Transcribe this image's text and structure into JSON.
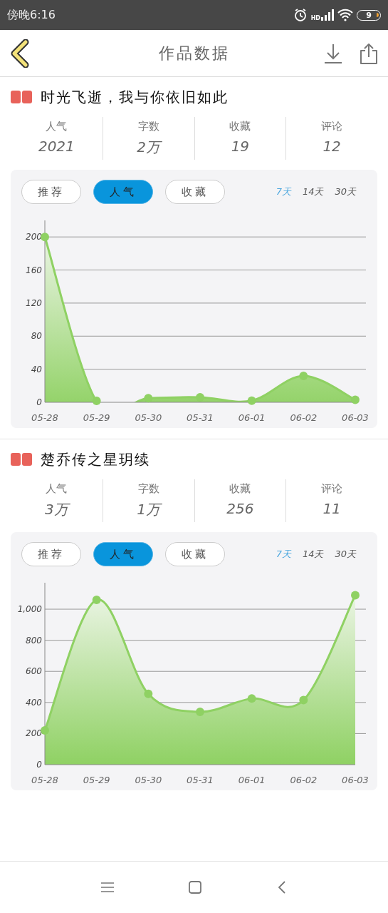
{
  "status_bar": {
    "time": "傍晚6:16",
    "network": "HD",
    "battery": "9"
  },
  "header": {
    "title": "作品数据"
  },
  "works": [
    {
      "title": "时光飞逝，我与你依旧如此",
      "stats": [
        {
          "label": "人气",
          "value": "2021"
        },
        {
          "label": "字数",
          "value": "2万"
        },
        {
          "label": "收藏",
          "value": "19"
        },
        {
          "label": "评论",
          "value": "12"
        }
      ],
      "metric_tabs": [
        {
          "label": "推荐",
          "selected": false
        },
        {
          "label": "人气",
          "selected": true
        },
        {
          "label": "收藏",
          "selected": false
        }
      ],
      "ranges": [
        {
          "label": "7天",
          "selected": true
        },
        {
          "label": "14天",
          "selected": false
        },
        {
          "label": "30天",
          "selected": false
        }
      ],
      "chart_data": {
        "type": "area",
        "grid": true,
        "categories": [
          "05-28",
          "05-29",
          "05-30",
          "05-31",
          "06-01",
          "06-02",
          "06-03"
        ],
        "ylim": [
          0,
          220
        ],
        "yticks": [
          0,
          40,
          80,
          120,
          160,
          200
        ],
        "series": [
          {
            "color": "#8fd163",
            "values": [
              200,
              1,
              5,
              6,
              2,
              32,
              3
            ]
          }
        ]
      }
    },
    {
      "title": "楚乔传之星玥续",
      "stats": [
        {
          "label": "人气",
          "value": "3万"
        },
        {
          "label": "字数",
          "value": "1万"
        },
        {
          "label": "收藏",
          "value": "256"
        },
        {
          "label": "评论",
          "value": "11"
        }
      ],
      "metric_tabs": [
        {
          "label": "推荐",
          "selected": false
        },
        {
          "label": "人气",
          "selected": true
        },
        {
          "label": "收藏",
          "selected": false
        }
      ],
      "ranges": [
        {
          "label": "7天",
          "selected": true
        },
        {
          "label": "14天",
          "selected": false
        },
        {
          "label": "30天",
          "selected": false
        }
      ],
      "chart_data": {
        "type": "area",
        "grid": true,
        "categories": [
          "05-28",
          "05-29",
          "05-30",
          "05-31",
          "06-01",
          "06-02",
          "06-03"
        ],
        "ylim": [
          0,
          1170
        ],
        "yticks": [
          0,
          200,
          400,
          600,
          800,
          {
            "value": 1000,
            "label": "1,000"
          }
        ],
        "series": [
          {
            "color": "#8fd163",
            "values": [
              220,
              1060,
              455,
              340,
              425,
              415,
              1090
            ]
          }
        ]
      }
    }
  ]
}
